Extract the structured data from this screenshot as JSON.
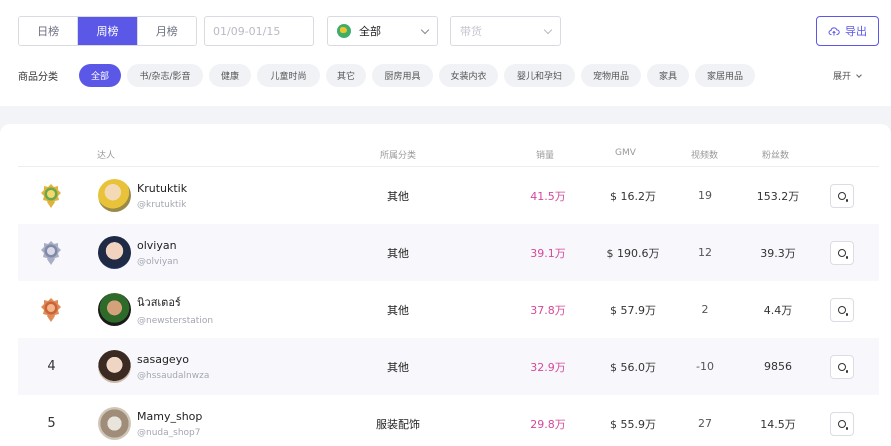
{
  "period_tabs": [
    "日榜",
    "周榜",
    "月榜"
  ],
  "date_range": "01/09-01/15",
  "region_select": {
    "value": "全部",
    "color": "#3fae6a"
  },
  "goods_select": {
    "placeholder": "带货"
  },
  "export_label": "导出",
  "category_label": "商品分类",
  "categories": [
    "全部",
    "书/杂志/影音",
    "健康",
    "儿童时尚",
    "其它",
    "厨房用具",
    "女装内衣",
    "婴儿和孕妇",
    "宠物用品",
    "家具",
    "家居用品"
  ],
  "expand_label": "展开",
  "table_headers": {
    "creator": "达人",
    "category": "所属分类",
    "sales": "销量",
    "gmv": "GMV",
    "videos": "视频数",
    "fans": "粉丝数"
  },
  "accent_color": "#5b58e8",
  "sales_color": "#d6479a",
  "rows": [
    {
      "rank": "1",
      "medal": "gold",
      "name": "Krutuktik",
      "handle": "@krutuktik",
      "category": "其他",
      "sales": "41.5万",
      "gmv": "$ 16.2万",
      "videos": "19",
      "fans": "153.2万"
    },
    {
      "rank": "2",
      "medal": "silver",
      "name": "olviyan",
      "handle": "@olviyan",
      "category": "其他",
      "sales": "39.1万",
      "gmv": "$ 190.6万",
      "videos": "12",
      "fans": "39.3万"
    },
    {
      "rank": "3",
      "medal": "bronze",
      "name": "นิวสเตอร์",
      "handle": "@newsterstation",
      "category": "其他",
      "sales": "37.8万",
      "gmv": "$ 57.9万",
      "videos": "2",
      "fans": "4.4万"
    },
    {
      "rank": "4",
      "medal": "",
      "name": "sasageyo",
      "handle": "@hssaudalnwza",
      "category": "其他",
      "sales": "32.9万",
      "gmv": "$ 56.0万",
      "videos": "-10",
      "fans": "9856"
    },
    {
      "rank": "5",
      "medal": "",
      "name": "Mamy_shop",
      "handle": "@nuda_shop7",
      "category": "服装配饰",
      "sales": "29.8万",
      "gmv": "$ 55.9万",
      "videos": "27",
      "fans": "14.5万"
    }
  ]
}
